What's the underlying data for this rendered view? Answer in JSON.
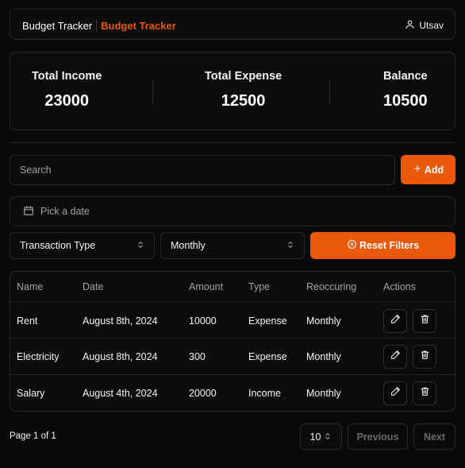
{
  "header": {
    "brand_plain": "Budget Tracker",
    "brand_accent": "Budget Tracker",
    "user_name": "Utsav",
    "user_icon": "user-icon"
  },
  "stats": {
    "income_label": "Total Income",
    "income_value": "23000",
    "expense_label": "Total Expense",
    "expense_value": "12500",
    "balance_label": "Balance",
    "balance_value": "10500"
  },
  "toolbar": {
    "search_placeholder": "Search",
    "add_label": "Add",
    "date_placeholder": "Pick a date",
    "type_select": "Transaction Type",
    "frequency_select": "Monthly",
    "reset_label": "Reset Filters"
  },
  "table": {
    "columns": [
      "Name",
      "Date",
      "Amount",
      "Type",
      "Reoccuring",
      "Actions"
    ],
    "rows": [
      {
        "name": "Rent",
        "date": "August 8th, 2024",
        "amount": "10000",
        "type": "Expense",
        "recurring": "Monthly"
      },
      {
        "name": "Electricity",
        "date": "August 8th, 2024",
        "amount": "300",
        "type": "Expense",
        "recurring": "Monthly"
      },
      {
        "name": "Salary",
        "date": "August 4th, 2024",
        "amount": "20000",
        "type": "Income",
        "recurring": "Monthly"
      }
    ]
  },
  "pagination": {
    "page_info": "Page 1 of 1",
    "page_size": "10",
    "previous_label": "Previous",
    "next_label": "Next"
  },
  "colors": {
    "accent": "#ea580c",
    "background": "#0a0a0a",
    "border": "#2a2a2a"
  }
}
